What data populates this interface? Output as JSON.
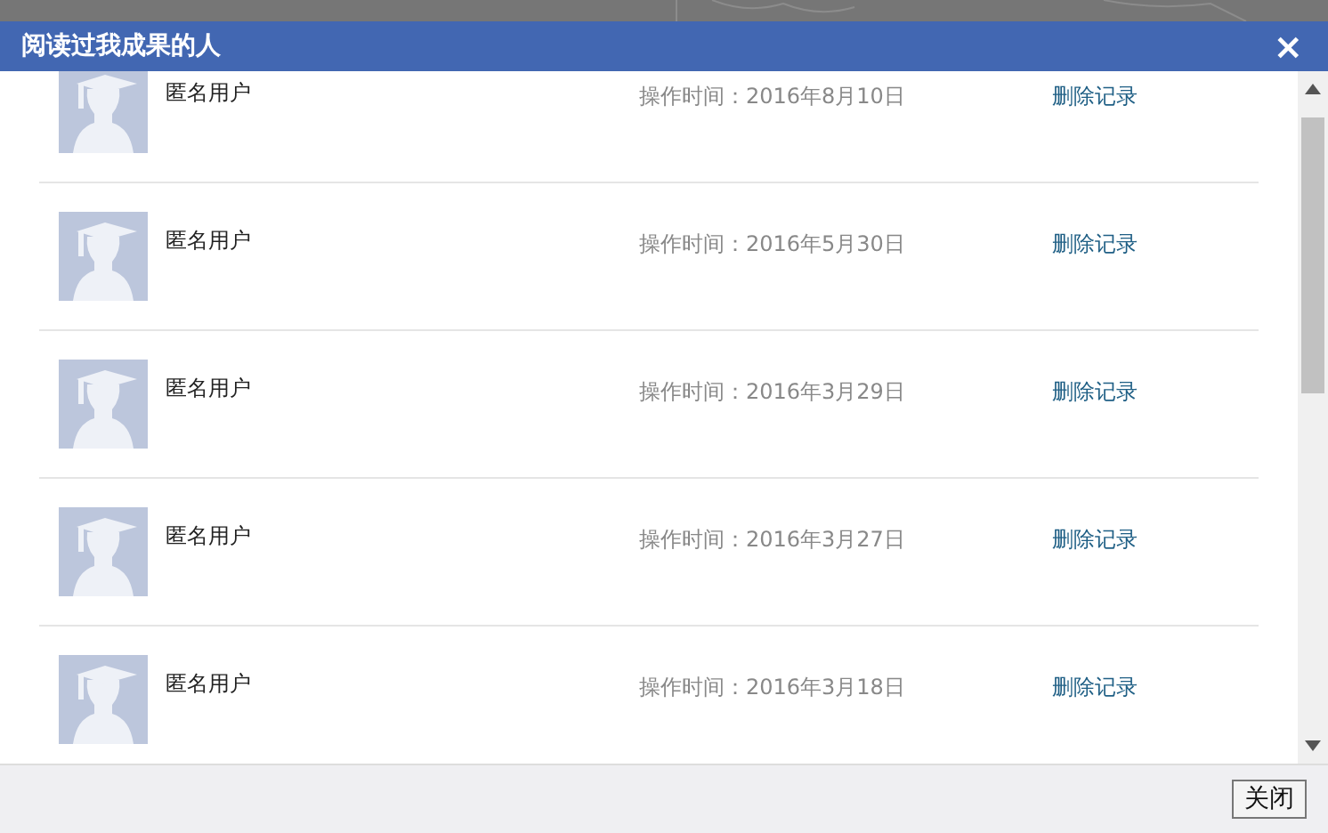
{
  "dialog": {
    "title": "阅读过我成果的人",
    "close_icon": "×"
  },
  "rows": [
    {
      "name": "匿名用户",
      "time": "操作时间：2016年8月10日",
      "action": "删除记录"
    },
    {
      "name": "匿名用户",
      "time": "操作时间：2016年5月30日",
      "action": "删除记录"
    },
    {
      "name": "匿名用户",
      "time": "操作时间：2016年3月29日",
      "action": "删除记录"
    },
    {
      "name": "匿名用户",
      "time": "操作时间：2016年3月27日",
      "action": "删除记录"
    },
    {
      "name": "匿名用户",
      "time": "操作时间：2016年3月18日",
      "action": "删除记录"
    }
  ],
  "buttons": [
    "关闭"
  ]
}
